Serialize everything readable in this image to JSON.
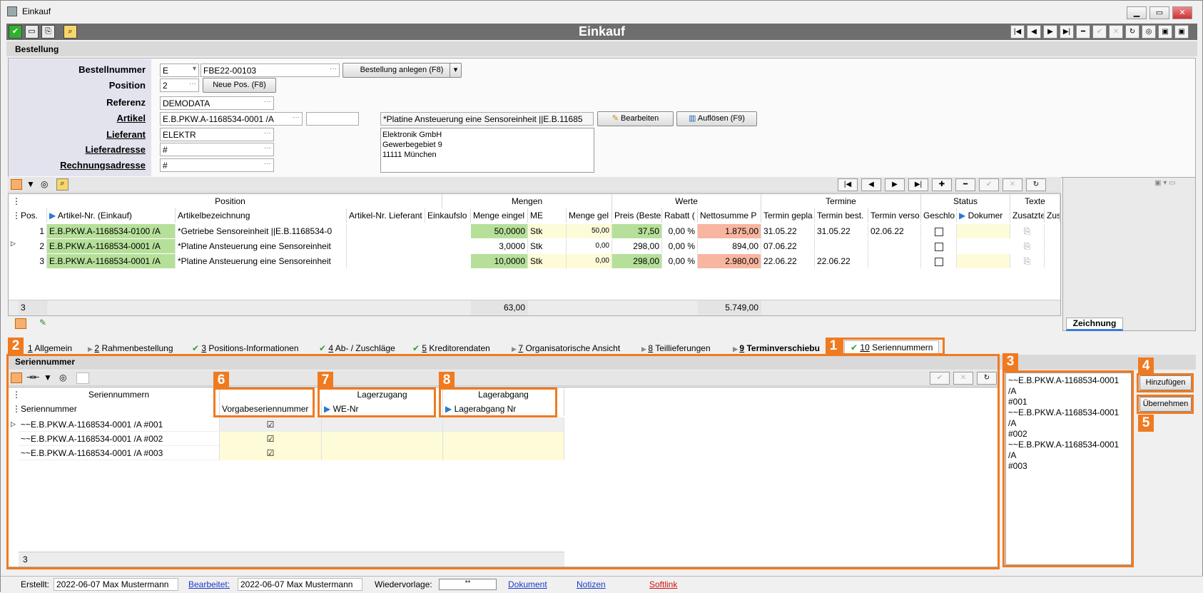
{
  "window": {
    "title": "Einkauf",
    "app_title": "Einkauf"
  },
  "section": {
    "bestellung": "Bestellung"
  },
  "form": {
    "labels": {
      "bestellnummer": "Bestellnummer",
      "position": "Position",
      "referenz": "Referenz",
      "artikel": "Artikel",
      "lieferant": "Lieferant",
      "lieferadresse": "Lieferadresse",
      "rechnungsadresse": "Rechnungsadresse"
    },
    "bestell_prefix": "E",
    "bestellnummer": "FBE22-00103",
    "bestellung_anlegen": "Bestellung anlegen (F8)",
    "position": "2",
    "neue_pos": "Neue Pos. (F8)",
    "referenz": "DEMODATA",
    "artikel": "E.B.PKW.A-1168534-0001 /A",
    "artikel_desc": "*Platine Ansteuerung eine Sensoreinheit   ||E.B.11685",
    "bearbeiten": "Bearbeiten",
    "aufloesen": "Auflösen (F9)",
    "lieferant": "ELEKTR",
    "lieferadresse": "#",
    "rechnungsadresse": "#",
    "address": [
      "Elektronik GmbH",
      "Gewerbegebiet 9",
      "11111 München"
    ]
  },
  "grid": {
    "groups": [
      "Position",
      "Mengen",
      "Werte",
      "Termine",
      "Status",
      "Texte"
    ],
    "columns": [
      "Pos.",
      "Artikel-Nr. (Einkauf)",
      "Artikelbezeichnung",
      "Artikel-Nr. Lieferant",
      "Einkaufslo",
      "Menge eingel",
      "ME",
      "Menge gel",
      "Preis (Beste",
      "Rabatt (",
      "Nettosumme P",
      "Termin gepla",
      "Termin best.",
      "Termin verso",
      "Geschlo",
      "Dokumer",
      "Zusatzte",
      "Zusa"
    ],
    "rows": [
      [
        "1",
        "E.B.PKW.A-1168534-0100 /A",
        "*Getriebe Sensoreinheit    ||E.B.1168534-0",
        "",
        "",
        "50,0000",
        "Stk",
        "50,00",
        "37,50",
        "0,00 %",
        "1.875,00",
        "31.05.22",
        "31.05.22",
        "02.06.22"
      ],
      [
        "2",
        "E.B.PKW.A-1168534-0001 /A",
        "*Platine Ansteuerung eine Sensoreinheit",
        "",
        "",
        "3,0000",
        "Stk",
        "0,00",
        "298,00",
        "0,00 %",
        "894,00",
        "07.06.22",
        "",
        ""
      ],
      [
        "3",
        "E.B.PKW.A-1168534-0001 /A",
        "*Platine Ansteuerung eine Sensoreinheit",
        "",
        "",
        "10,0000",
        "Stk",
        "0,00",
        "298,00",
        "0,00 %",
        "2.980,00",
        "22.06.22",
        "22.06.22",
        ""
      ]
    ],
    "footer": {
      "count": "3",
      "menge_sum": "63,00",
      "netto_sum": "5.749,00"
    }
  },
  "side": {
    "zeichnung": "Zeichnung"
  },
  "tabs": [
    {
      "num": "1",
      "label": "Allgemein"
    },
    {
      "num": "2",
      "label": "Rahmenbestellung"
    },
    {
      "num": "3",
      "label": "Positions-Informationen"
    },
    {
      "num": "4",
      "label": "Ab- / Zuschläge"
    },
    {
      "num": "5",
      "label": "Kreditorendaten"
    },
    {
      "num": "7",
      "label": "Organisatorische Ansicht"
    },
    {
      "num": "8",
      "label": "Teillieferungen"
    },
    {
      "num": "9",
      "label": "Terminverschiebu"
    },
    {
      "num": "10",
      "label": "Seriennummern"
    }
  ],
  "serial": {
    "section": "Seriennummer",
    "group_sn": "Seriennummern",
    "col_sn": "Seriennummer",
    "col_vorgabe": "Vorgabeseriennummer",
    "group_zugang": "Lagerzugang",
    "col_zugang": "WE-Nr",
    "group_abgang": "Lagerabgang",
    "col_abgang": "Lagerabgang Nr",
    "rows": [
      "~~E.B.PKW.A-1168534-0001 /A #001",
      "~~E.B.PKW.A-1168534-0001 /A #002",
      "~~E.B.PKW.A-1168534-0001 /A #003"
    ],
    "count": "3",
    "textarea_lines": [
      "~~E.B.PKW.A-1168534-0001 /A",
      "#001",
      "~~E.B.PKW.A-1168534-0001 /A",
      "#002",
      "~~E.B.PKW.A-1168534-0001 /A",
      "#003"
    ],
    "hinzufuegen": "Hinzufügen",
    "uebernehmen": "Übernehmen"
  },
  "badges": [
    "1",
    "2",
    "3",
    "4",
    "5",
    "6",
    "7",
    "8"
  ],
  "status": {
    "erstellt_label": "Erstellt:",
    "erstellt": "2022-06-07  Max Mustermann",
    "bearbeitet_label": "Bearbeitet:",
    "bearbeitet": "2022-06-07  Max Mustermann",
    "wiedervorlage_label": "Wiedervorlage:",
    "wiedervorlage": "**",
    "dokument": "Dokument",
    "notizen": "Notizen",
    "softlink": "Softlink"
  },
  "colors": {
    "accent": "#f07a20",
    "green": "#b6e09a",
    "yellow": "#fefbd8",
    "salmon": "#f8b6a0",
    "header": "#6e6e6e"
  }
}
